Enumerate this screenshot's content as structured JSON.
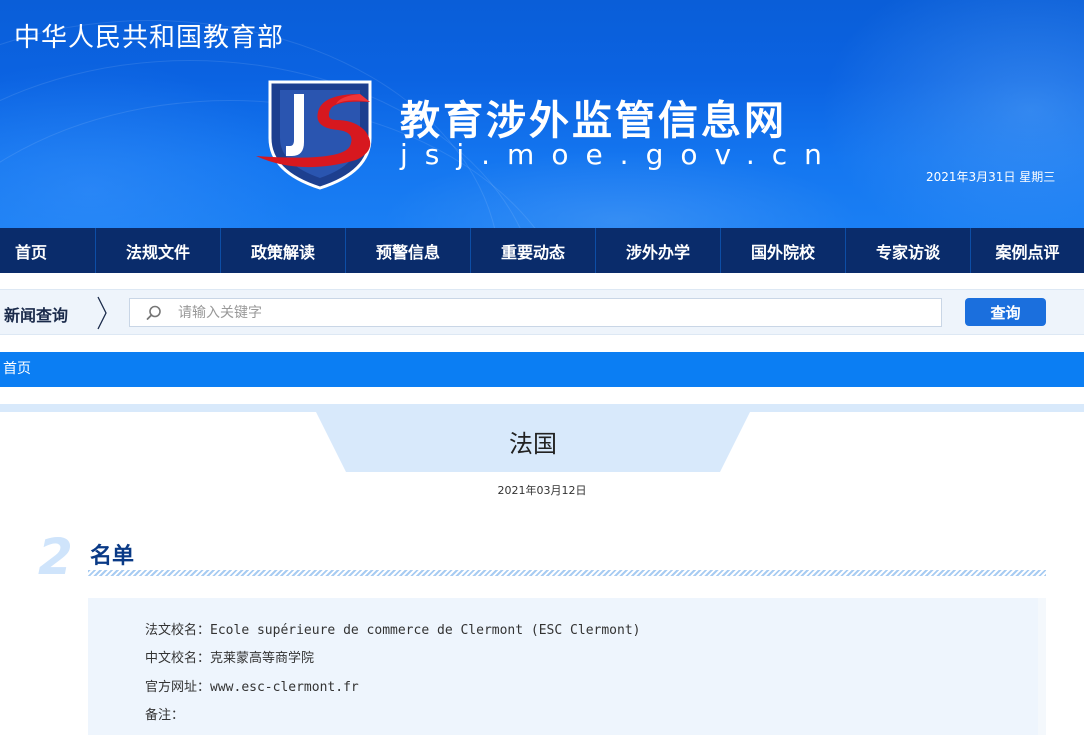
{
  "header": {
    "ministry": "中华人民共和国教育部",
    "site_title": "教育涉外监管信息网",
    "site_domain": "jsj.moe.gov.cn",
    "date": "2021年3月31日 星期三",
    "logo_icon": "shield-js-logo-icon",
    "colors": {
      "banner": "#0b63e2",
      "logo_red": "#d7181f"
    }
  },
  "nav": {
    "items": [
      {
        "label": "首页"
      },
      {
        "label": "法规文件"
      },
      {
        "label": "政策解读"
      },
      {
        "label": "预警信息"
      },
      {
        "label": "重要动态"
      },
      {
        "label": "涉外办学"
      },
      {
        "label": "国外院校"
      },
      {
        "label": "专家访谈"
      },
      {
        "label": "案例点评"
      }
    ],
    "background": "#0a2c6b"
  },
  "search": {
    "title": "新闻查询",
    "placeholder": "请输入关键字",
    "value": "",
    "button_label": "查询",
    "icon": "search-icon"
  },
  "breadcrumb": {
    "label": "首页"
  },
  "article": {
    "title": "法国",
    "date": "2021年03月12日",
    "section": {
      "number": "2",
      "title": "名单"
    },
    "fields": [
      {
        "label": "法文校名：",
        "value": "Ecole supérieure de commerce de Clermont (ESC Clermont)"
      },
      {
        "label": "中文校名：",
        "value": "克莱蒙高等商学院"
      },
      {
        "label": "官方网址：",
        "value": "www.esc-clermont.fr"
      },
      {
        "label": "备注：",
        "value": ""
      }
    ]
  }
}
